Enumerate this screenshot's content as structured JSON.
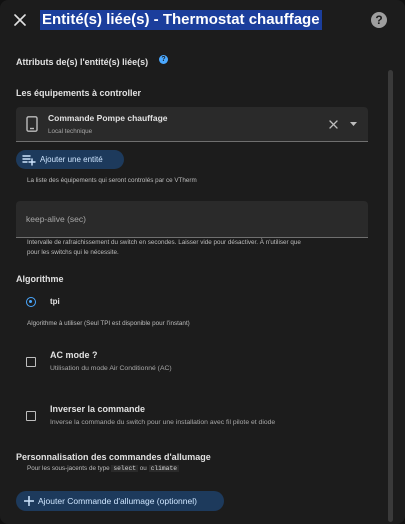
{
  "dialog": {
    "title": "Entité(s) liée(s) - Thermostat chauffage",
    "help_label": "?"
  },
  "linked_attrs": {
    "title": "Attributs de(s) l'entité(s) liée(s)",
    "info_label": "?"
  },
  "equipments": {
    "title": "Les équipements à controller",
    "entity": {
      "name": "Commande Pompe chauffage",
      "source": "Local technique",
      "icon": "phone-switch-icon"
    },
    "add_button": "Ajouter une entité",
    "help": "La liste des équipements qui seront controlés par ce VTherm"
  },
  "keep_alive": {
    "placeholder": "keep-alive (sec)",
    "help_line1": "Intervalle de rafraichissement du switch en secondes. Laisser vide pour désactiver. À n'utiliser que",
    "help_line2": "pour les switchs qui le nécessite."
  },
  "algorithm": {
    "title": "Algorithme",
    "selected": "tpi",
    "help": "Algorithme à utiliser (Seul TPI est disponible pour l'instant)"
  },
  "ac_mode": {
    "label": "AC mode ?",
    "description": "Utilisation du mode Air Conditionné (AC)",
    "checked": false
  },
  "inverse": {
    "label": "Inverser la commande",
    "description": "Inverse la commande du switch pour une installation avec fil pilote et diode",
    "checked": false
  },
  "commands": {
    "title": "Personnalisation des commandes d'allumage",
    "hint_prefix": "Pour les sous-jacents de type",
    "hint_select": "select",
    "hint_or": "ou",
    "hint_climate": "climate",
    "add_button": "Ajouter Commande d'allumage (optionnel)"
  },
  "colors": {
    "accent": "#4aa8ff",
    "title_highlight": "#1b3e9c",
    "button_bg": "#1d3a5c",
    "surface": "#1c1c1c",
    "field": "#2a2a2a"
  }
}
